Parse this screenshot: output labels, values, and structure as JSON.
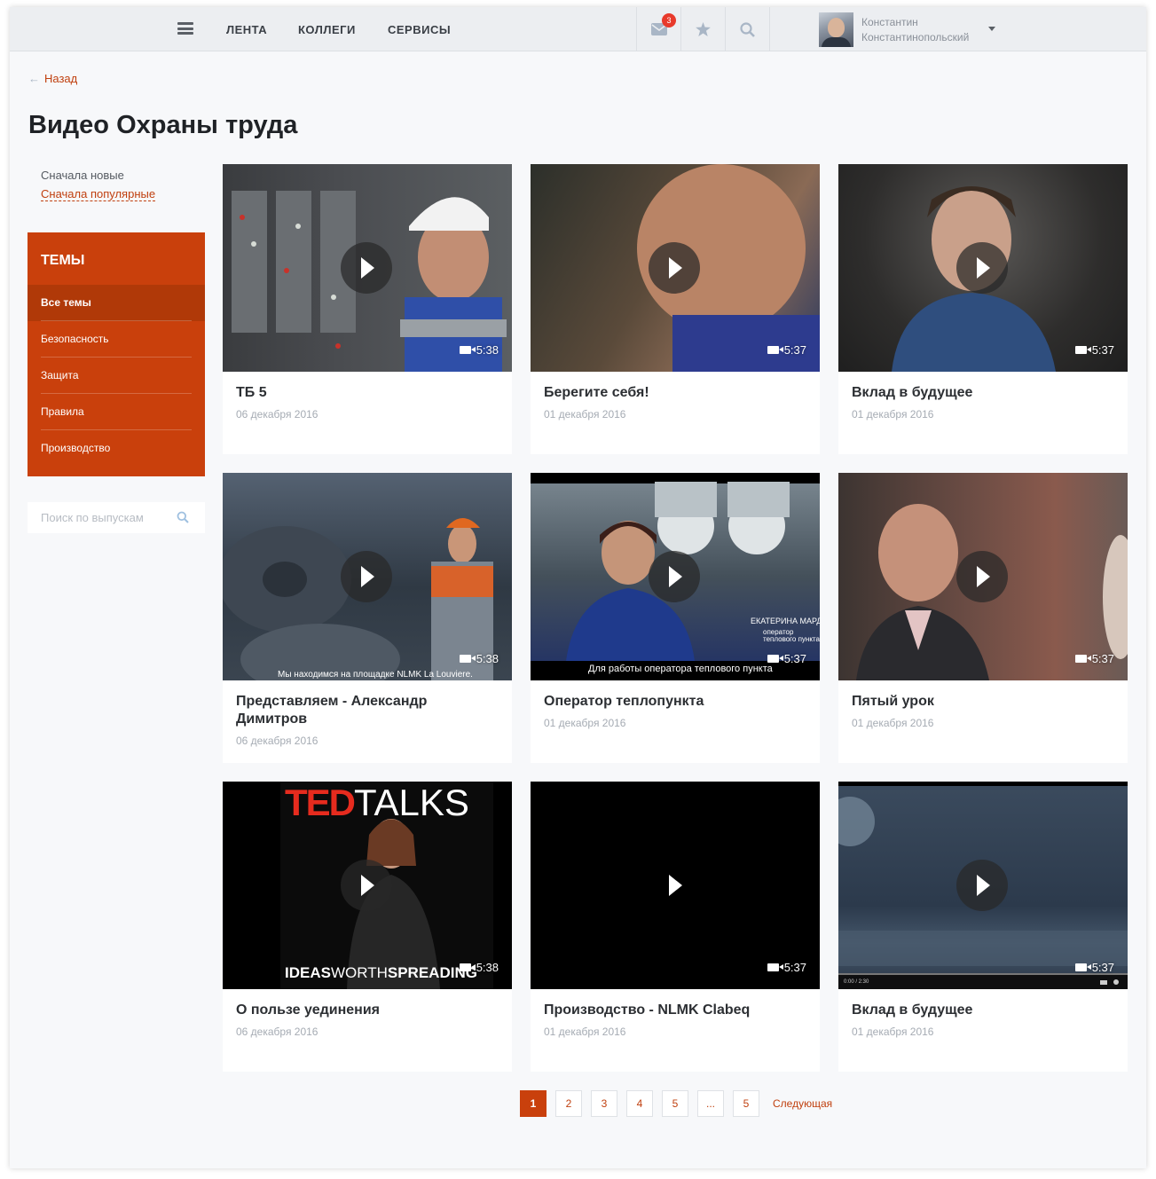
{
  "header": {
    "nav": [
      "ЛЕНТА",
      "КОЛЛЕГИ",
      "СЕРВИСЫ"
    ],
    "notifications_count": "3",
    "user": {
      "first_name": "Константин",
      "last_name": "Константинопольский"
    }
  },
  "back_label": "Назад",
  "page_title": "Видео Охраны труда",
  "sort": {
    "newest": "Сначала новые",
    "popular": "Сначала популярные"
  },
  "themes": {
    "title": "Темы",
    "items": [
      "Все темы",
      "Безопасность",
      "Защита",
      "Правила",
      "Производство"
    ]
  },
  "search": {
    "placeholder": "Поиск по выпускам"
  },
  "videos": [
    {
      "title": "ТБ 5",
      "date": "06 декабря 2016",
      "duration": "5:38"
    },
    {
      "title": "Берегите себя!",
      "date": "01 декабря 2016",
      "duration": "5:37"
    },
    {
      "title": "Вклад в будущее",
      "date": "01 декабря 2016",
      "duration": "5:37"
    },
    {
      "title": "Представляем - Александр Димитров",
      "date": "06 декабря 2016",
      "duration": "5:38",
      "caption": "Мы находимся на площадке NLMK La Louviere."
    },
    {
      "title": "Оператор теплопункта",
      "date": "01 декабря 2016",
      "duration": "5:37",
      "caption": "Для работы оператора теплового пункта",
      "overlay_name": "ЕКАТЕРИНА МАРД",
      "overlay_role": "оператор теплового пункта"
    },
    {
      "title": "Пятый урок",
      "date": "01 декабря 2016",
      "duration": "5:37"
    },
    {
      "title": "О пользе уединения",
      "date": "06 декабря 2016",
      "duration": "5:38",
      "brand_top_a": "TED",
      "brand_top_b": "TALKS",
      "brand_bottom_a": "IDEAS",
      "brand_bottom_b": "WORTH",
      "brand_bottom_c": "SPREADING"
    },
    {
      "title": "Производство - NLMK Clabeq",
      "date": "01 декабря 2016",
      "duration": "5:37"
    },
    {
      "title": "Вклад в будущее",
      "date": "01 декабря 2016",
      "duration": "5:37",
      "player_time": "0:00 / 2:30"
    }
  ],
  "pagination": {
    "pages": [
      "1",
      "2",
      "3",
      "4",
      "5",
      "...",
      "5"
    ],
    "current": "1",
    "next": "Следующая"
  },
  "colors": {
    "accent": "#c9400c",
    "link": "#c0400f",
    "bg": "#f7f8fa",
    "badge": "#e83a2c"
  }
}
